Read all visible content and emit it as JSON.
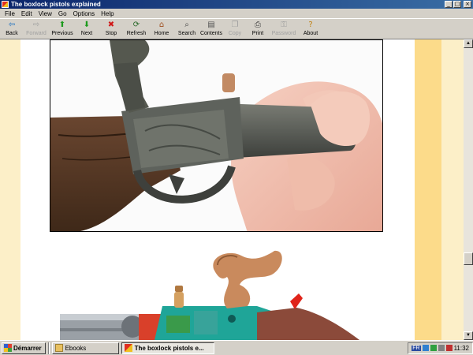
{
  "window": {
    "title": "The boxlock pistols explained",
    "controls": {
      "minimize": "_",
      "maximize": "□",
      "close": "×"
    }
  },
  "menu": [
    "File",
    "Edit",
    "View",
    "Go",
    "Options",
    "Help"
  ],
  "toolbar": [
    {
      "label": "Back",
      "icon": "back-arrow-icon",
      "glyph": "⇦",
      "color": "#1a6fc0",
      "enabled": true
    },
    {
      "label": "Forward",
      "icon": "forward-arrow-icon",
      "glyph": "⇨",
      "color": "#a0a0a0",
      "enabled": false
    },
    {
      "label": "Previous",
      "icon": "up-arrow-icon",
      "glyph": "⬆",
      "color": "#1d9a1d",
      "enabled": true
    },
    {
      "label": "Next",
      "icon": "down-arrow-icon",
      "glyph": "⬇",
      "color": "#1d9a1d",
      "enabled": true
    },
    {
      "label": "Stop",
      "icon": "stop-icon",
      "glyph": "✖",
      "color": "#d01818",
      "enabled": true
    },
    {
      "label": "Refresh",
      "icon": "refresh-icon",
      "glyph": "⟳",
      "color": "#2a6a2a",
      "enabled": true
    },
    {
      "label": "Home",
      "icon": "home-icon",
      "glyph": "⌂",
      "color": "#a05020",
      "enabled": true
    },
    {
      "label": "Search",
      "icon": "search-icon",
      "glyph": "⌕",
      "color": "#404040",
      "enabled": true
    },
    {
      "label": "Contents",
      "icon": "contents-icon",
      "glyph": "▤",
      "color": "#505050",
      "enabled": true
    },
    {
      "label": "Copy",
      "icon": "copy-icon",
      "glyph": "❐",
      "color": "#a0a0a0",
      "enabled": false
    },
    {
      "label": "Print",
      "icon": "print-icon",
      "glyph": "⎙",
      "color": "#404040",
      "enabled": true
    },
    {
      "label": "Password",
      "icon": "key-icon",
      "glyph": "⚿",
      "color": "#a0a0a0",
      "enabled": false
    },
    {
      "label": "About",
      "icon": "about-icon",
      "glyph": "?",
      "color": "#c08010",
      "enabled": true
    }
  ],
  "taskbar": {
    "start_label": "Démarrer",
    "tasks": [
      {
        "label": "Ebooks",
        "active": false,
        "icon": "folder-icon"
      },
      {
        "label": "The boxlock pistols e...",
        "active": true,
        "icon": "ebook-icon"
      }
    ],
    "lang": "FR",
    "clock": "11:32"
  },
  "colors": {
    "title_start": "#0a246a",
    "title_end": "#3a6ea5",
    "page_side": "#fcefc8",
    "page_band": "#fcdb8a"
  }
}
